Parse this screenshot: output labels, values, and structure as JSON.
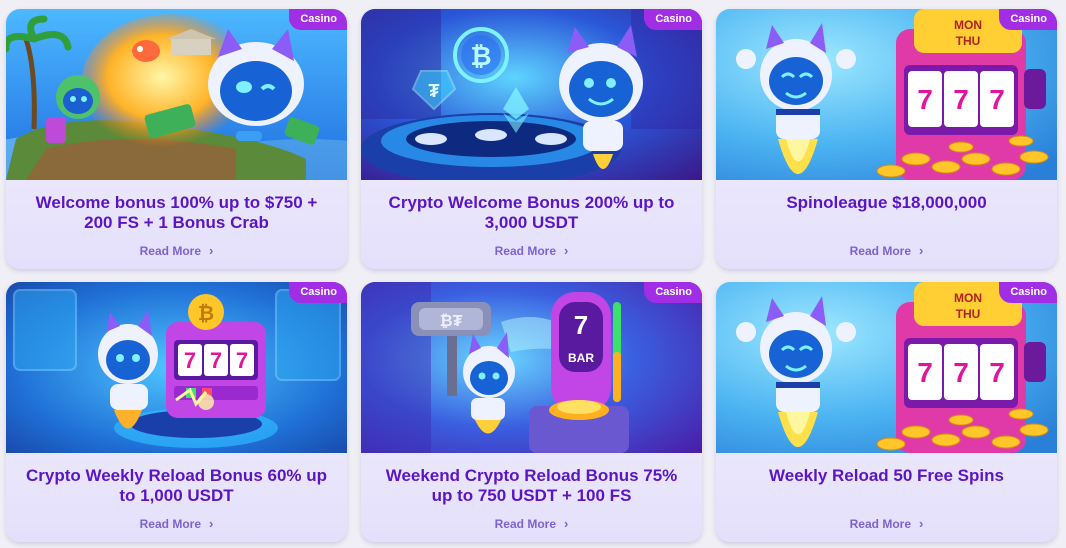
{
  "cards": [
    {
      "tag": "Casino",
      "title": "Welcome bonus 100% up to $750 + 200 FS + 1 Bonus Crab",
      "link": "Read More",
      "art": "island",
      "chevron": "›"
    },
    {
      "tag": "Casino",
      "title": "Crypto Welcome Bonus 200% up to 3,000 USDT",
      "link": "Read More",
      "art": "crypto",
      "chevron": "›"
    },
    {
      "tag": "Casino",
      "title": "Spinoleague $18,000,000",
      "link": "Read More",
      "art": "slot-monthu",
      "chevron": "›",
      "sign_top": "MON",
      "sign_bottom": "THU",
      "reels": "777"
    },
    {
      "tag": "Casino",
      "title": "Crypto Weekly Reload Bonus 60% up to 1,000 USDT",
      "link": "Read More",
      "art": "slot-lab",
      "chevron": "›"
    },
    {
      "tag": "Casino",
      "title": "Weekend Crypto Reload Bonus 75% up to 750 USDT + 100 FS",
      "link": "Read More",
      "art": "hammer",
      "chevron": "›",
      "machine_label": "BAR",
      "machine_digit": "7"
    },
    {
      "tag": "Casino",
      "title": "Weekly Reload 50 Free Spins",
      "link": "Read More",
      "art": "slot-monthu",
      "chevron": "›",
      "sign_top": "MON",
      "sign_bottom": "THU",
      "reels": "777"
    }
  ],
  "colors": {
    "tag_bg": "#a12ee4",
    "title": "#5b16c4",
    "link": "#7d63cf",
    "card_bg": "#ece9fd",
    "page_bg": "#efeff5"
  }
}
